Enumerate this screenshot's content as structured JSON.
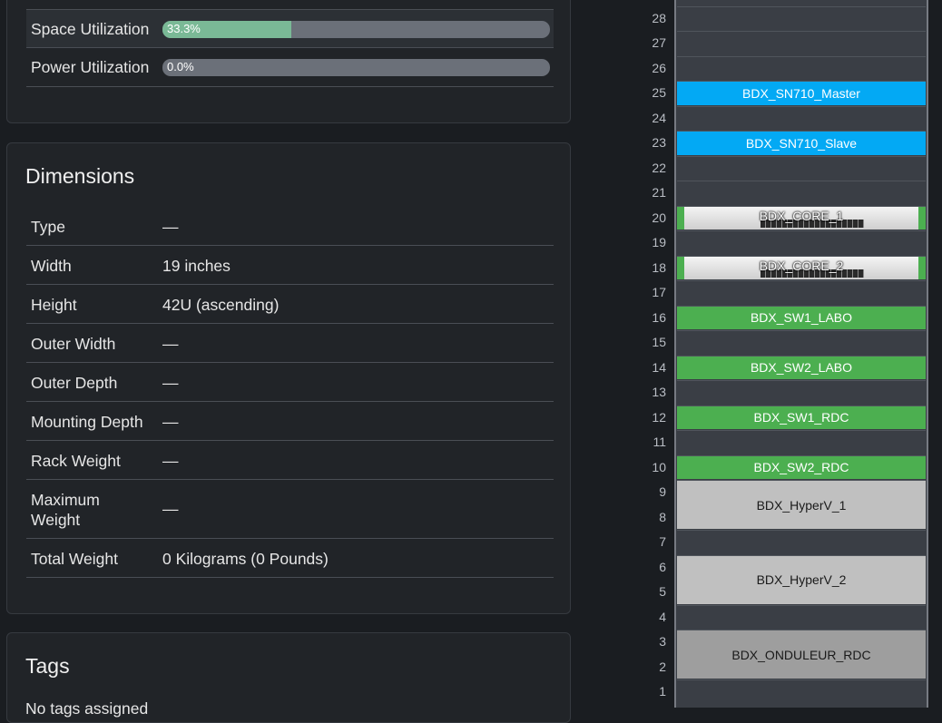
{
  "utilization": {
    "rows": [
      {
        "label": "Space Utilization",
        "percent": 33.3,
        "text": "33.3%"
      },
      {
        "label": "Power Utilization",
        "percent": 0.0,
        "text": "0.0%"
      }
    ]
  },
  "dimensions": {
    "title": "Dimensions",
    "rows": [
      {
        "label": "Type",
        "value": "—"
      },
      {
        "label": "Width",
        "value": "19 inches"
      },
      {
        "label": "Height",
        "value": "42U (ascending)"
      },
      {
        "label": "Outer Width",
        "value": "—"
      },
      {
        "label": "Outer Depth",
        "value": "—"
      },
      {
        "label": "Mounting Depth",
        "value": "—"
      },
      {
        "label": "Rack Weight",
        "value": "—"
      },
      {
        "label": "Maximum Weight",
        "value": "—"
      },
      {
        "label": "Total Weight",
        "value": "0 Kilograms (0 Pounds)"
      }
    ]
  },
  "tags": {
    "title": "Tags",
    "empty_text": "No tags assigned"
  },
  "rack": {
    "units": [
      "28",
      "27",
      "26",
      "25",
      "24",
      "23",
      "22",
      "21",
      "20",
      "19",
      "18",
      "17",
      "16",
      "15",
      "14",
      "13",
      "12",
      "11",
      "10",
      "9",
      "8",
      "7",
      "6",
      "5",
      "4",
      "3",
      "2",
      "1"
    ],
    "devices": [
      {
        "name": "BDX_SN710_Master",
        "unit": 25,
        "height": 1,
        "color": "#03a9f4",
        "text_color": "#ffffff",
        "style": "color"
      },
      {
        "name": "BDX_SN710_Slave",
        "unit": 23,
        "height": 1,
        "color": "#03a9f4",
        "text_color": "#ffffff",
        "style": "color"
      },
      {
        "name": "BDX_CORE_1",
        "unit": 20,
        "height": 1,
        "color": "#4caf50",
        "text_color": "#ffffff",
        "style": "image"
      },
      {
        "name": "BDX_CORE_2",
        "unit": 18,
        "height": 1,
        "color": "#4caf50",
        "text_color": "#ffffff",
        "style": "image"
      },
      {
        "name": "BDX_SW1_LABO",
        "unit": 16,
        "height": 1,
        "color": "#4caf50",
        "text_color": "#ffffff",
        "style": "color"
      },
      {
        "name": "BDX_SW2_LABO",
        "unit": 14,
        "height": 1,
        "color": "#4caf50",
        "text_color": "#ffffff",
        "style": "color"
      },
      {
        "name": "BDX_SW1_RDC",
        "unit": 12,
        "height": 1,
        "color": "#4caf50",
        "text_color": "#ffffff",
        "style": "color"
      },
      {
        "name": "BDX_SW2_RDC",
        "unit": 10,
        "height": 1,
        "color": "#4caf50",
        "text_color": "#ffffff",
        "style": "color"
      },
      {
        "name": "BDX_HyperV_1",
        "unit": 8,
        "height": 2,
        "color": "#c0c0c0",
        "text_color": "#1a1a1a",
        "style": "color"
      },
      {
        "name": "BDX_HyperV_2",
        "unit": 5,
        "height": 2,
        "color": "#c0c0c0",
        "text_color": "#1a1a1a",
        "style": "color"
      },
      {
        "name": "BDX_ONDULEUR_RDC",
        "unit": 2,
        "height": 2,
        "color": "#9e9e9e",
        "text_color": "#1a1a1a",
        "style": "color"
      }
    ]
  }
}
